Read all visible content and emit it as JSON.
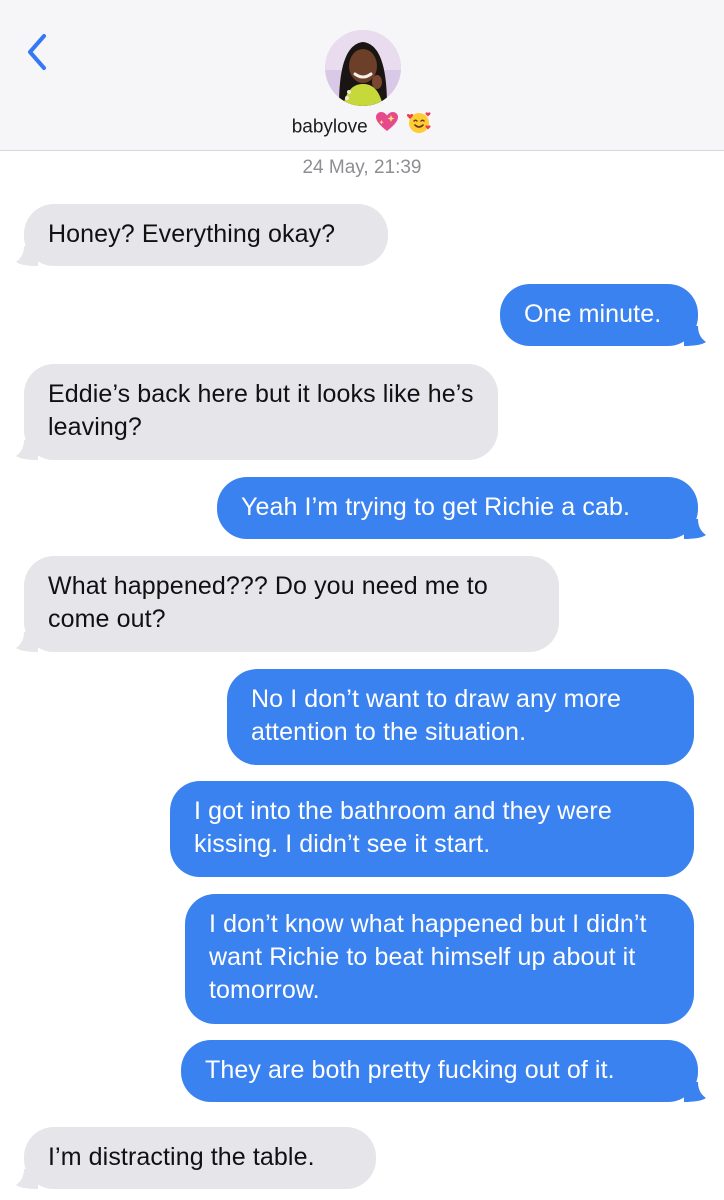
{
  "header": {
    "contact_name": "babylove",
    "back_label": "<",
    "status_emojis": [
      "sparkling-heart",
      "smiling-face-with-hearts"
    ]
  },
  "thread": {
    "timestamp": "24 May, 21:39",
    "messages": [
      {
        "from": "them",
        "text": "Honey? Everything okay?"
      },
      {
        "from": "me",
        "text": "One minute."
      },
      {
        "from": "them",
        "text": "Eddie’s back here but it looks like he’s leaving?"
      },
      {
        "from": "me",
        "text": "Yeah I’m trying to get Richie a cab."
      },
      {
        "from": "them",
        "text": "What happened??? Do you need me to come out?"
      },
      {
        "from": "me",
        "text": "No I don’t want to draw any more attention to the situation."
      },
      {
        "from": "me",
        "text": "I got into the bathroom and they were kissing. I didn’t see it start."
      },
      {
        "from": "me",
        "text": "I don’t know what happened but I didn’t want Richie to beat himself up about it tomorrow."
      },
      {
        "from": "me",
        "text": "They are both pretty fucking out of it."
      },
      {
        "from": "them",
        "text": "I’m distracting the table."
      }
    ]
  },
  "colors": {
    "sent_bubble": "#3b82f1",
    "received_bubble": "#e5e5ea",
    "accent": "#3478f6",
    "timestamp": "#8e8e93"
  }
}
